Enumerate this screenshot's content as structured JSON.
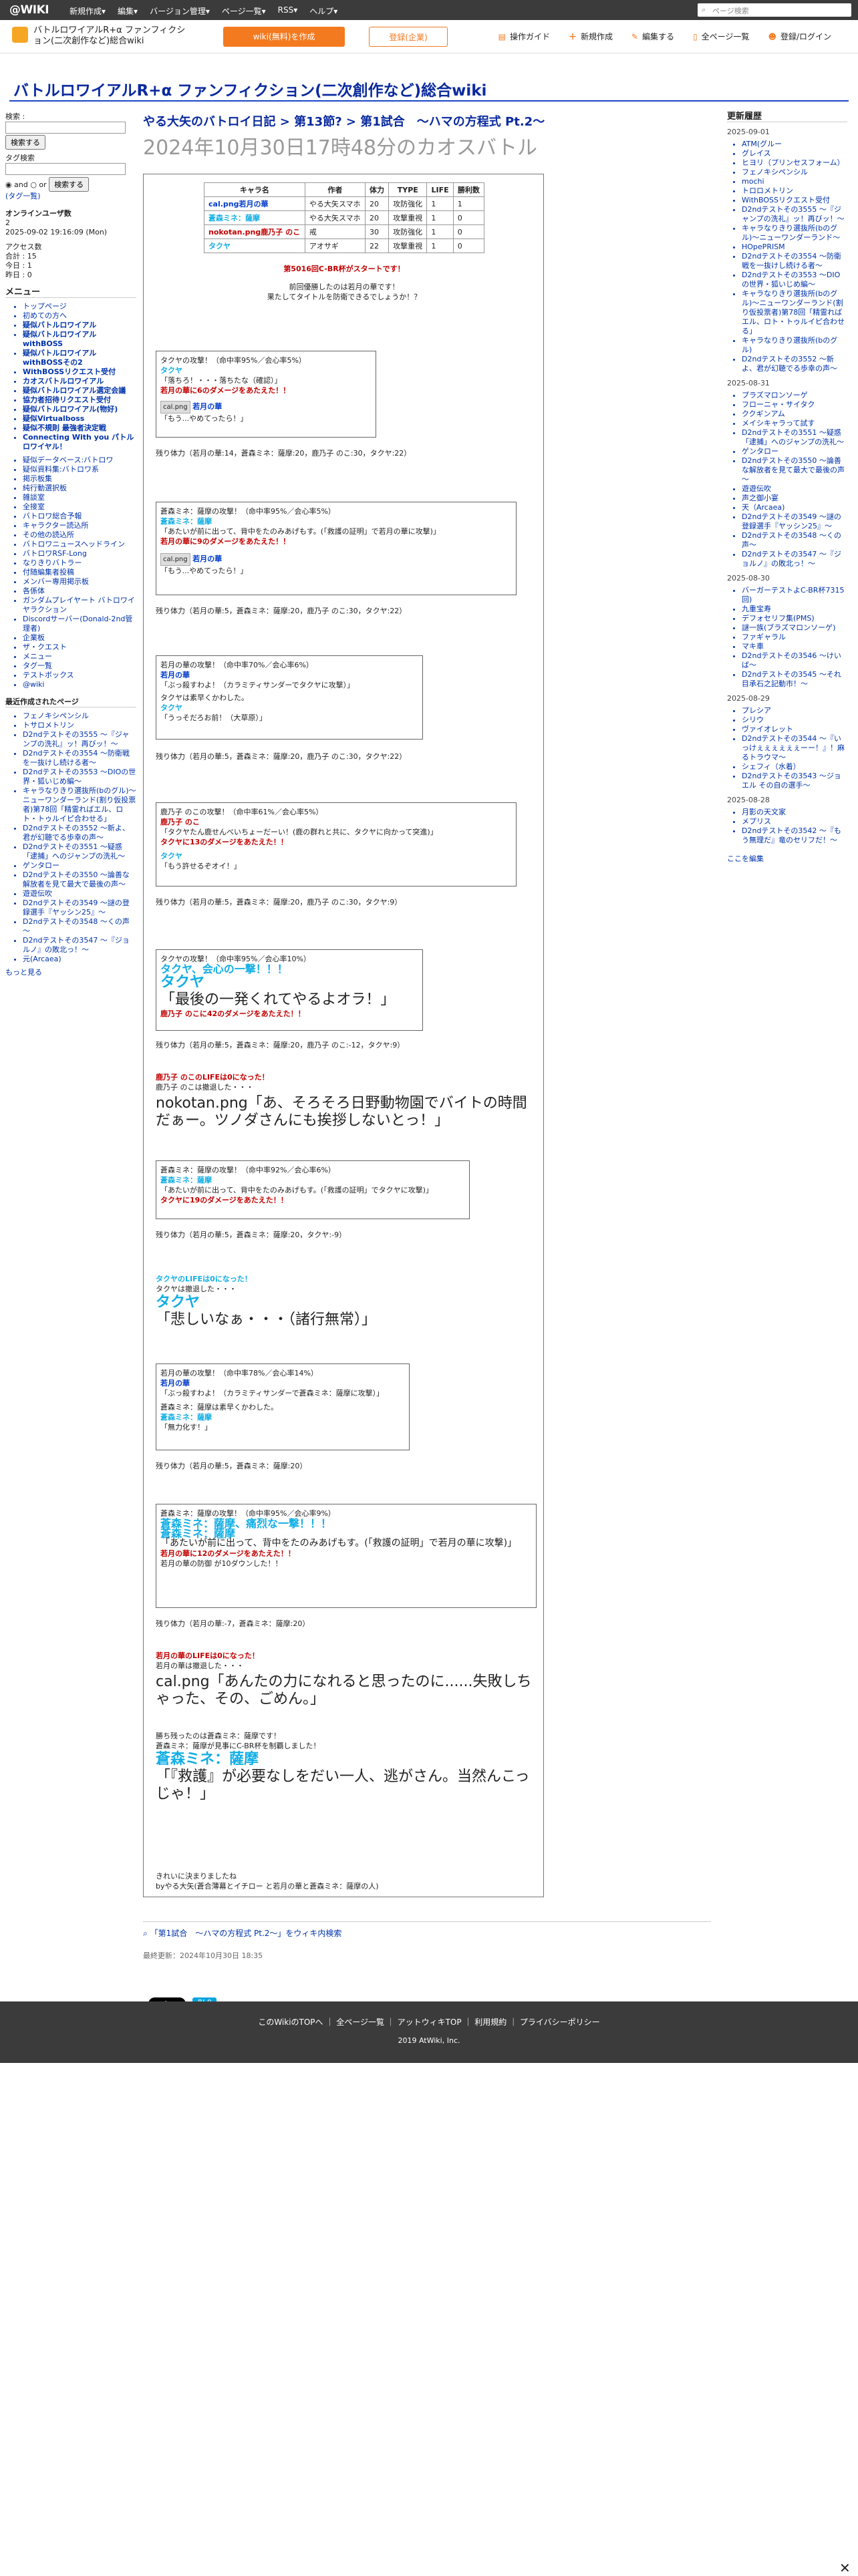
{
  "topbar": {
    "logo": "@WIKI",
    "menu": [
      "新規作成▾",
      "編集▾",
      "バージョン管理▾",
      "ページ一覧▾",
      "RSS▾",
      "ヘルプ▾"
    ],
    "search_placeholder": "ページ検索"
  },
  "header": {
    "site": "バトルロワイアルR+α ファンフィクション(二次創作など)総合wiki",
    "btn_new_wiki": "wiki(無料)を作成",
    "btn_members": "登録(企業)",
    "tools": [
      "操作ガイド",
      "新規作成",
      "編集する",
      "全ページ一覧",
      "登録/ログイン"
    ]
  },
  "page_title": "バトルロワイアルR+α ファンフィクション(二次創作など)総合wiki",
  "left": {
    "search_label": "検索 :",
    "search_btn": "検索する",
    "tag_label": "タグ検索",
    "and": "and",
    "or": "or",
    "search_btn2": "検索する",
    "tag_list": "(タグ一覧)",
    "online_head": "オンラインユーザ数",
    "online": "2",
    "date": "2025-09-02 19:16:09 (Mon)",
    "access_head": "アクセス数",
    "total": "合計 : 15",
    "today": "今日 : 1",
    "yesterday": "昨日 : 0",
    "menu_head": "メニュー",
    "menu": [
      "トップページ",
      "初めての方へ",
      "疑似バトルロワイアル",
      "疑似バトルロワイアルwithBOSS",
      "疑似バトルロワイアルwithBOSSその2",
      "WithBOSSリクエスト受付",
      "カオスバトルロワイアル",
      "疑似バトルロワイアル選定会議",
      "協力者招待リクエスト受付",
      "疑似バトルロワイアル(物好)",
      "疑似Virtualboss",
      "疑似不規則 最強者決定戦",
      "Connecting With you パトルロワイヤル！"
    ],
    "sub_items": [
      "疑似データベース:バトロワ",
      "疑似資料集:バトロワ系",
      "掲示板集",
      "純行動選択板",
      "雑談室",
      "全接室",
      "バトロワ総合予報",
      "キャラクター読込所",
      "その他の読込所",
      "バトロワニュースヘッドライン",
      "バトロワRSF-Long",
      "なりきりバトラー",
      "付随編集者投稿",
      "メンバー専用掲示板",
      "各係体",
      "ガンダムプレイヤート バトロワイヤラクション",
      "Discordサーバー(Donald-2nd管理者)",
      "企業板",
      "ザ・クエスト",
      "メニュー",
      "タグ一覧",
      "テストボックス",
      "@wiki"
    ],
    "recent_head": "最近作成されたページ",
    "recent": [
      "フェノキシペンシル",
      "トサロメトリン",
      "D2ndテストその3555 ～『ジャンプの洗礼』ッ！再びッ！～",
      "D2ndテストその3554 ～防衛戦を一抜けし続ける者～",
      "D2ndテストその3553 ～DIOの世界・狐いじめ編～",
      "キャラなりきり選抜所(bのグル)～ニューワンダーランド(割り仮投票者)第78回「精霊ればエル、ロト・トゥルイピ合わせる」",
      "D2ndテストその3552 ～新よ、君が幻聴でる歩幸の声～",
      "D2ndテストその3551 ～疑惑「逮捕」へのジャンプの洗礼～",
      "ゲンタロー",
      "D2ndテストその3550 ～論善な解放者を見て最大で最後の声～",
      "遊遊伝吹",
      "D2ndテストその3549 ～謎の登録選手『ヤッシン25』～",
      "D2ndテストその3548 ～くの声～",
      "D2ndテストその3547 ～『ジョルノ』の敗北っ！～",
      "元(Arcaea)"
    ],
    "more": "もっと見る"
  },
  "main": {
    "breadcrumb": "やる大矢のバトロイ日記 > 第13節? > 第1試合　～ハマの方程式 Pt.2～",
    "subtitle": "2024年10月30日17時48分のカオスバトル",
    "table_head": [
      "キャラ名",
      "作者",
      "体力",
      "TYPE",
      "LIFE",
      "勝利数"
    ],
    "table_rows": [
      [
        "cal.png若月の華",
        "やる大矢スマホ",
        "20",
        "攻防強化",
        "1",
        "1"
      ],
      [
        "蒼森ミネ：薩摩",
        "やる大矢スマホ",
        "20",
        "攻撃重視",
        "1",
        "0"
      ],
      [
        "nokotan.png鹿乃子 のこ",
        "戒",
        "30",
        "攻防強化",
        "1",
        "0"
      ],
      [
        "タクヤ",
        "アオサギ",
        "22",
        "攻撃重視",
        "1",
        "0"
      ]
    ],
    "intro": "第5016回C-BR杯がスタートです！",
    "intro2": "前回優勝したのは若月の華です！",
    "intro3": "果たしてタイトルを防衛できるでしょうか！？",
    "rem1": "残り体力（若月の華:14，蒼森ミネ：薩摩:20，鹿乃子 のこ:30，タクヤ:22）",
    "rem2": "残り体力（若月の華:5，蒼森ミネ：薩摩:20，鹿乃子 のこ:30，タクヤ:22）",
    "rem3": "残り体力（若月の華:5，蒼森ミネ：薩摩:20，鹿乃子 のこ:30，タクヤ:22）",
    "rem4": "残り体力（若月の華:5，蒼森ミネ：薩摩:20，鹿乃子 のこ:30，タクヤ:9）",
    "rem5": "残り体力（若月の華:5，蒼森ミネ：薩摩:20，鹿乃子 のこ:-12，タクヤ:9）",
    "rem6": "残り体力（若月の華:5，蒼森ミネ：薩摩:20，タクヤ:-9）",
    "rem7": "残り体力（若月の華:5，蒼森ミネ：薩摩:20）",
    "rem8": "残り体力（若月の華:-7，蒼森ミネ：薩摩:20）",
    "b1_l1": "タクヤの攻撃！（命中率95%／会心率5%）",
    "b1_l2": "タクヤ",
    "b1_l3": "「落ちろ！・・・落ちたな（確認）」",
    "b1_l4": "若月の華に6のダメージをあたえた！！",
    "b1_l5": "若月の華",
    "b1_l6": "「もう...やめてったら！」",
    "b2_l1": "蒼森ミネ：薩摩の攻撃！（命中率95%／会心率5%）",
    "b2_l2": "蒼森ミネ：薩摩",
    "b2_l3": "「あたいが前に出って、背中をたのみあげもす。(「救護の証明」で若月の華に攻撃)」",
    "b2_l4": "若月の華に9のダメージをあたえた！！",
    "b2_l5": "若月の華",
    "b2_l6": "「もう...やめてったら！」",
    "b3_l1": "若月の華の攻撃！（命中率70%／会心率6%）",
    "b3_l2": "若月の華",
    "b3_l3": "「ぶっ殺すわよ！（カラミティサンダーでタクヤに攻撃）」",
    "b3_l4": "タクヤは素早くかわした。",
    "b3_l5": "タクヤ",
    "b3_l6": "「うっそだろお前！（大草原）」",
    "b4_l1": "鹿乃子 のこの攻撃！（命中率61%／会心率5%）",
    "b4_l2": "鹿乃子 のこ",
    "b4_l3": "「タクヤたん鹿せんべいちょーだーい！(鹿の群れと共に、タクヤに向かって突進)」",
    "b4_l4": "タクヤに13のダメージをあたえた！！",
    "b4_l5": "タクヤ",
    "b4_l6": "「もう許せるぞオイ！」",
    "b5_l1": "タクヤの攻撃！（命中率95%／会心率10%）",
    "b5_l2": "タクヤ、会心の一撃！！！",
    "b5_l3": "タクヤ",
    "b5_l4": "「最後の一発くれてやるよオラ！」",
    "b5_l5": "鹿乃子 のこに42のダメージをあたえた！！",
    "ko1a": "鹿乃子 のこのLIFEは0になった！",
    "ko1b": "鹿乃子 のこは撤退した・・・",
    "ko1c": "nokotan.png「あ、そろそろ日野動物園でバイトの時間だぁー。ツノダさんにも挨拶しないとっ！」",
    "b6_l1": "蒼森ミネ：薩摩の攻撃！（命中率92%／会心率6%）",
    "b6_l2": "蒼森ミネ：薩摩",
    "b6_l3": "「あたいが前に出って、背中をたのみあげもす。(「救護の証明」でタクヤに攻撃)」",
    "b6_l4": "タクヤに19のダメージをあたえた！！",
    "ko2a": "タクヤのLIFEは0になった！",
    "ko2b": "タクヤは撤退した・・・",
    "ko2c": "タクヤ",
    "ko2d": "「悲しいなぁ・・・（諸行無常）」",
    "b7_l1": "若月の華の攻撃！（命中率78%／会心率14%）",
    "b7_l2": "若月の華",
    "b7_l3": "「ぶっ殺すわよ！（カラミティサンダーで蒼森ミネ：薩摩に攻撃）」",
    "b7_l4": "蒼森ミネ：薩摩は素早くかわした。",
    "b7_l5": "蒼森ミネ：薩摩",
    "b7_l6": "「無力化す！」",
    "b8_l1": "蒼森ミネ：薩摩の攻撃！（命中率95%／会心率9%）",
    "b8_l2": "蒼森ミネ：薩摩、痛烈な一撃！！！",
    "b8_l3": "蒼森ミネ：薩摩",
    "b8_l4": "「あたいが前に出って、背中をたのみあげもす。(「救護の証明」で若月の華に攻撃)」",
    "b8_l5": "若月の華に12のダメージをあたえた！！",
    "b8_l6": "若月の華の防御 が10ダウンした！！",
    "ko3a": "若月の華のLIFEは0になった！",
    "ko3b": "若月の華は撤退した・・・",
    "ko3c": "cal.png「あんたの力になれると思ったのに......失敗しちゃった、その、ごめん。」",
    "win1": "勝ち残ったのは蒼森ミネ：薩摩です！",
    "win2": "蒼森ミネ：薩摩が見事にC-BR杯を制覇しました！",
    "win3": "蒼森ミネ：薩摩",
    "win4": "「『救護』が必要なしをだい一人、逃がさん。当然んこっじゃ！」",
    "end1": "きれいに決まりましたね",
    "end2": "byやる大矢(蒼合薄幕とイチロー と若月の華と蒼森ミネ：薩摩の人)",
    "related": "「第1試合　～ハマの方程式 Pt.2～」をウィキ内検索",
    "updated": "最終更新：2024年10月30日 18:35",
    "share1": "X ポスト",
    "share2": "B! 0"
  },
  "right": {
    "head": "更新履歴",
    "groups": [
      {
        "date": "2025-09-01",
        "items": [
          "ATM(グルー",
          "グレイス",
          "ヒヨリ（プリンセスフォーム）",
          "フェノキシペンシル",
          "mochi",
          "トロロメトリン",
          "WithBOSSリクエスト受付",
          "D2ndテストその3555 ～『ジャンプの洗礼』ッ！再びッ！～",
          "キャラなりきり選抜所(bのグル)～ニューワンダーランド～",
          "HOpePRISM",
          "D2ndテストその3554 ～防衛戦を一抜けし続ける者～",
          "D2ndテストその3553 ～DIOの世界・狐いじめ編～",
          "キャラなりきり選抜所(bのグル)～ニューワンダーランド(割り仮投票者)第78回「精霊ればエル、ロト・トゥルイピ合わせる」",
          "キャラなりきり選抜所(bのグル)",
          "D2ndテストその3552 ～新よ、君が幻聴でる歩幸の声～"
        ]
      },
      {
        "date": "2025-08-31",
        "items": [
          "プラズマロンソーゲ",
          "フローニャ・サイタク",
          "ククギンアム",
          "メイシキャラって試す",
          "D2ndテストその3551 ～疑惑「逮捕」へのジャンプの洗礼～",
          "ゲンタロー",
          "D2ndテストその3550 ～論善な解放者を見て最大で最後の声～",
          "遊遊伝吹",
          "声之御小宴",
          "天（Arcaea)",
          "D2ndテストその3549 ～謎の登録選手『ヤッシン25』～",
          "D2ndテストその3548 ～くの声～",
          "D2ndテストその3547 ～『ジョルノ』の敗北っ！～"
        ]
      },
      {
        "date": "2025-08-30",
        "items": [
          "バーガーテストよC-BR杯7315回)",
          "九重宝寿",
          "デフォセリフ集(PMS)",
          "謎一族(ブラズマロンソーゲ)",
          "ファギャラル",
          "マキ車",
          "D2ndテストその3546 ～けいば～",
          "D2ndテストその3545 ～それ目承石之記動市！～"
        ]
      },
      {
        "date": "2025-08-29",
        "items": [
          "プレシア",
          "シリウ",
          "ヴァイオレット",
          "D2ndテストその3544 ～『いっけぇぇぇぇぇぇーー！』！麻るトラウマ～",
          "シェフィ（水着）",
          "D2ndテストその3543 ～ジョエル その自の選手～"
        ]
      },
      {
        "date": "2025-08-28",
        "items": [
          "月影の天文家",
          "メプリス",
          "D2ndテストその3542 ～『もう無理だ』竜のセリフだ！～"
        ]
      }
    ],
    "here": "ここを編集"
  },
  "footer": {
    "links": [
      "このWikiのTOPへ",
      "全ページ一覧",
      "アットウィキTOP",
      "利用規約",
      "プライバシーポリシー"
    ],
    "copy": "2019 AtWiki, Inc."
  }
}
